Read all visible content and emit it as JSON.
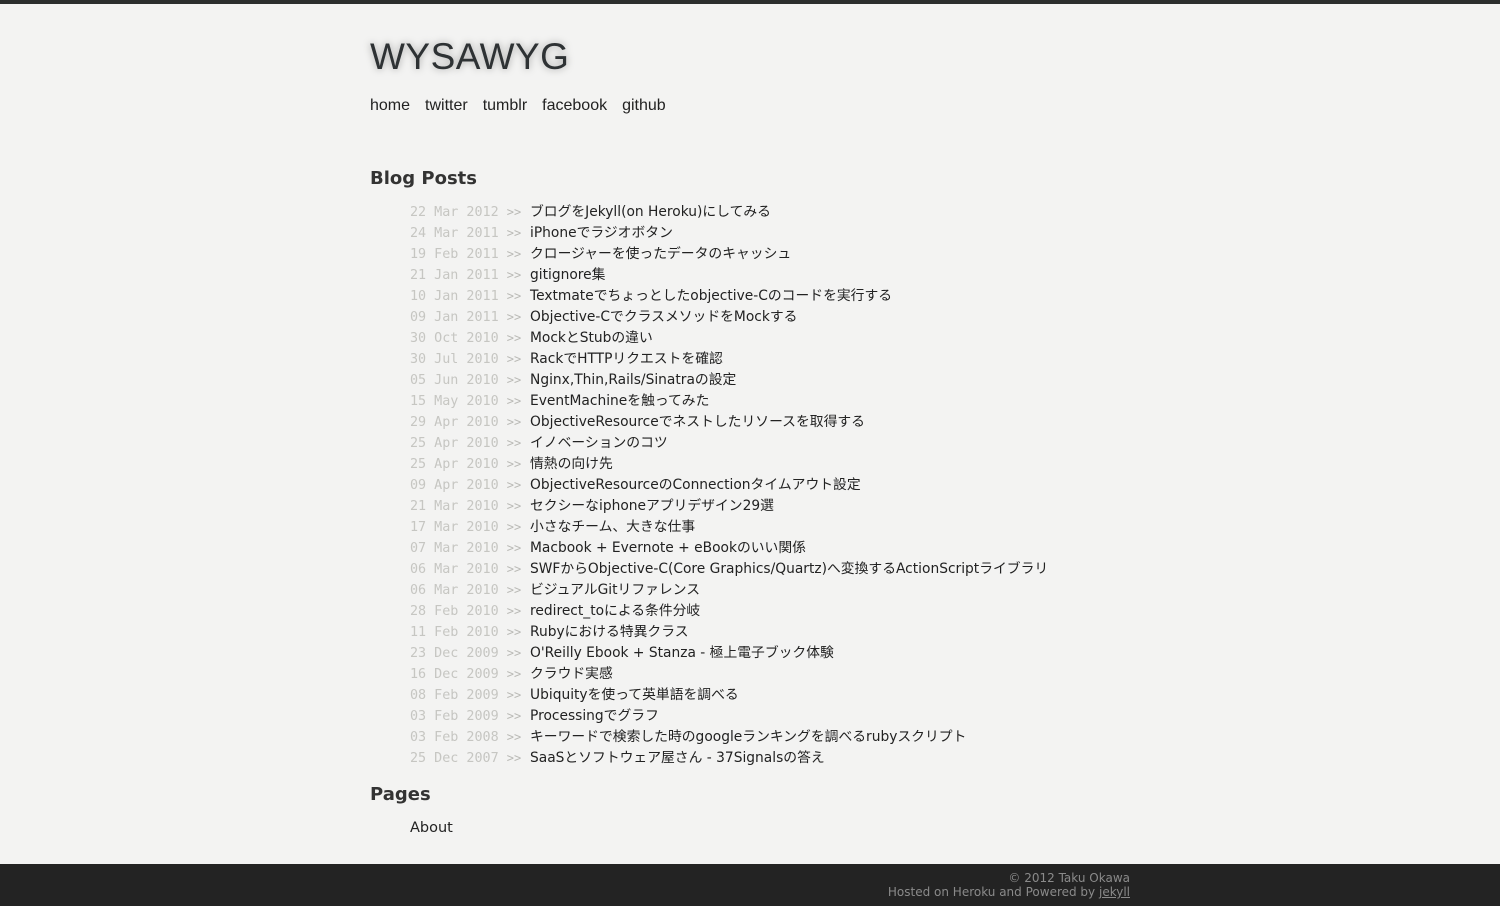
{
  "site": {
    "title": "WYSAWYG"
  },
  "nav": {
    "items": [
      {
        "label": "home"
      },
      {
        "label": "twitter"
      },
      {
        "label": "tumblr"
      },
      {
        "label": "facebook"
      },
      {
        "label": "github"
      }
    ]
  },
  "blog_posts": {
    "heading": "Blog Posts",
    "separator": ">>",
    "items": [
      {
        "date": "22 Mar 2012",
        "title": "ブログをJekyll(on Heroku)にしてみる"
      },
      {
        "date": "24 Mar 2011",
        "title": "iPhoneでラジオボタン"
      },
      {
        "date": "19 Feb 2011",
        "title": "クロージャーを使ったデータのキャッシュ"
      },
      {
        "date": "21 Jan 2011",
        "title": "gitignore集"
      },
      {
        "date": "10 Jan 2011",
        "title": "Textmateでちょっとしたobjective-Cのコードを実行する"
      },
      {
        "date": "09 Jan 2011",
        "title": "Objective-CでクラスメソッドをMockする"
      },
      {
        "date": "30 Oct 2010",
        "title": "MockとStubの違い"
      },
      {
        "date": "30 Jul 2010",
        "title": "RackでHTTPリクエストを確認"
      },
      {
        "date": "05 Jun 2010",
        "title": "Nginx,Thin,Rails/Sinatraの設定"
      },
      {
        "date": "15 May 2010",
        "title": "EventMachineを触ってみた"
      },
      {
        "date": "29 Apr 2010",
        "title": "ObjectiveResourceでネストしたリソースを取得する"
      },
      {
        "date": "25 Apr 2010",
        "title": "イノベーションのコツ"
      },
      {
        "date": "25 Apr 2010",
        "title": "情熱の向け先"
      },
      {
        "date": "09 Apr 2010",
        "title": "ObjectiveResourceのConnectionタイムアウト設定"
      },
      {
        "date": "21 Mar 2010",
        "title": "セクシーなiphoneアプリデザイン29選"
      },
      {
        "date": "17 Mar 2010",
        "title": "小さなチーム、大きな仕事"
      },
      {
        "date": "07 Mar 2010",
        "title": "Macbook + Evernote + eBookのいい関係"
      },
      {
        "date": "06 Mar 2010",
        "title": "SWFからObjective-C(Core Graphics/Quartz)へ変換するActionScriptライブラリ"
      },
      {
        "date": "06 Mar 2010",
        "title": "ビジュアルGitリファレンス"
      },
      {
        "date": "28 Feb 2010",
        "title": "redirect_toによる条件分岐"
      },
      {
        "date": "11 Feb 2010",
        "title": "Rubyにおける特異クラス"
      },
      {
        "date": "23 Dec 2009",
        "title": "O'Reilly Ebook + Stanza - 極上電子ブック体験"
      },
      {
        "date": "16 Dec 2009",
        "title": "クラウド実感"
      },
      {
        "date": "08 Feb 2009",
        "title": "Ubiquityを使って英単語を調べる"
      },
      {
        "date": "03 Feb 2009",
        "title": "Processingでグラフ"
      },
      {
        "date": "03 Feb 2008",
        "title": "キーワードで検索した時のgoogleランキングを調べるrubyスクリプト"
      },
      {
        "date": "25 Dec 2007",
        "title": "SaaSとソフトウェア屋さん - 37Signalsの答え"
      }
    ]
  },
  "pages": {
    "heading": "Pages",
    "items": [
      {
        "label": "About"
      }
    ]
  },
  "footer": {
    "copyright": "© 2012 Taku Okawa",
    "hosted_text": "Hosted on Heroku and Powered by",
    "jekyll_link": "jekyll"
  }
}
